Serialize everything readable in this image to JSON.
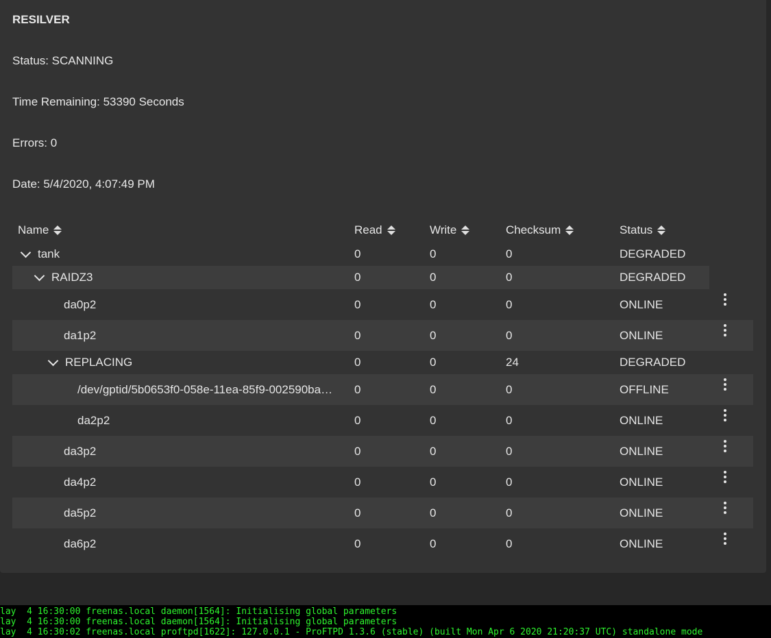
{
  "resilver": {
    "title": "RESILVER",
    "status": "Status: SCANNING",
    "time_remaining": "Time Remaining: 53390 Seconds",
    "errors": "Errors: 0",
    "date": "Date: 5/4/2020, 4:07:49 PM"
  },
  "table": {
    "headers": {
      "name": "Name",
      "read": "Read",
      "write": "Write",
      "checksum": "Checksum",
      "status": "Status"
    },
    "rows": [
      {
        "name": "tank",
        "read": "0",
        "write": "0",
        "checksum": "0",
        "status": "DEGRADED"
      },
      {
        "name": "RAIDZ3",
        "read": "0",
        "write": "0",
        "checksum": "0",
        "status": "DEGRADED"
      },
      {
        "name": "da0p2",
        "read": "0",
        "write": "0",
        "checksum": "0",
        "status": "ONLINE"
      },
      {
        "name": "da1p2",
        "read": "0",
        "write": "0",
        "checksum": "0",
        "status": "ONLINE"
      },
      {
        "name": "REPLACING",
        "read": "0",
        "write": "0",
        "checksum": "24",
        "status": "DEGRADED"
      },
      {
        "name": "/dev/gptid/5b0653f0-058e-11ea-85f9-002590ba…",
        "read": "0",
        "write": "0",
        "checksum": "0",
        "status": "OFFLINE"
      },
      {
        "name": "da2p2",
        "read": "0",
        "write": "0",
        "checksum": "0",
        "status": "ONLINE"
      },
      {
        "name": "da3p2",
        "read": "0",
        "write": "0",
        "checksum": "0",
        "status": "ONLINE"
      },
      {
        "name": "da4p2",
        "read": "0",
        "write": "0",
        "checksum": "0",
        "status": "ONLINE"
      },
      {
        "name": "da5p2",
        "read": "0",
        "write": "0",
        "checksum": "0",
        "status": "ONLINE"
      },
      {
        "name": "da6p2",
        "read": "0",
        "write": "0",
        "checksum": "0",
        "status": "ONLINE"
      }
    ]
  },
  "console": {
    "lines": [
      "lay  4 16:30:00 freenas.local daemon[1564]: Initialising global parameters",
      "lay  4 16:30:00 freenas.local daemon[1564]: Initialising global parameters",
      "lay  4 16:30:02 freenas.local proftpd[1622]: 127.0.0.1 - ProFTPD 1.3.6 (stable) (built Mon Apr 6 2020 21:20:37 UTC) standalone mode"
    ]
  },
  "icons": {
    "sort": "sort-icon",
    "expand": "chevron-down-icon",
    "menu": "more-vert-icon"
  },
  "colors": {
    "background": "#272727",
    "card": "#333333",
    "row_alt": "#3d3d3d",
    "console_text": "#2ef52e"
  }
}
